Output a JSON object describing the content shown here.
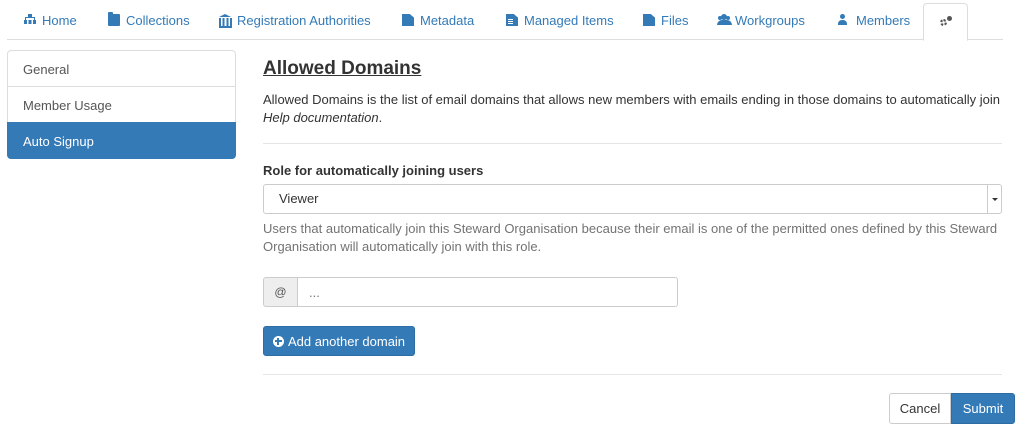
{
  "tabs": [
    {
      "label": "Home",
      "icon": "sitemap-icon"
    },
    {
      "label": "Collections",
      "icon": "folder-icon"
    },
    {
      "label": "Registration Authorities",
      "icon": "bank-icon"
    },
    {
      "label": "Metadata",
      "icon": "file-icon"
    },
    {
      "label": "Managed Items",
      "icon": "file-text-icon"
    },
    {
      "label": "Files",
      "icon": "file-icon"
    },
    {
      "label": "Workgroups",
      "icon": "users-icon"
    },
    {
      "label": "Members",
      "icon": "user-icon"
    },
    {
      "label": "",
      "icon": "cogs-icon",
      "active": true
    }
  ],
  "sidebar": {
    "items": [
      {
        "label": "General"
      },
      {
        "label": "Member Usage"
      },
      {
        "label": "Auto Signup",
        "active": true
      }
    ]
  },
  "main": {
    "title": "Allowed Domains",
    "description": "Allowed Domains is the list of email domains that allows new members with emails ending in those domains to automatically join",
    "help_link": "Help documentation",
    "help_link_suffix": ".",
    "role_label": "Role for automatically joining users",
    "role_value": "Viewer",
    "role_help": "Users that automatically join this Steward Organisation because their email is one of the permitted ones defined by this Steward Organisation will automatically join with this role.",
    "domain_addon": "@",
    "domain_placeholder": "...",
    "add_domain_label": "Add another domain"
  },
  "footer": {
    "cancel_label": "Cancel",
    "submit_label": "Submit"
  },
  "colors": {
    "accent": "#337ab7",
    "border": "#dddddd",
    "muted_text": "#737373"
  }
}
